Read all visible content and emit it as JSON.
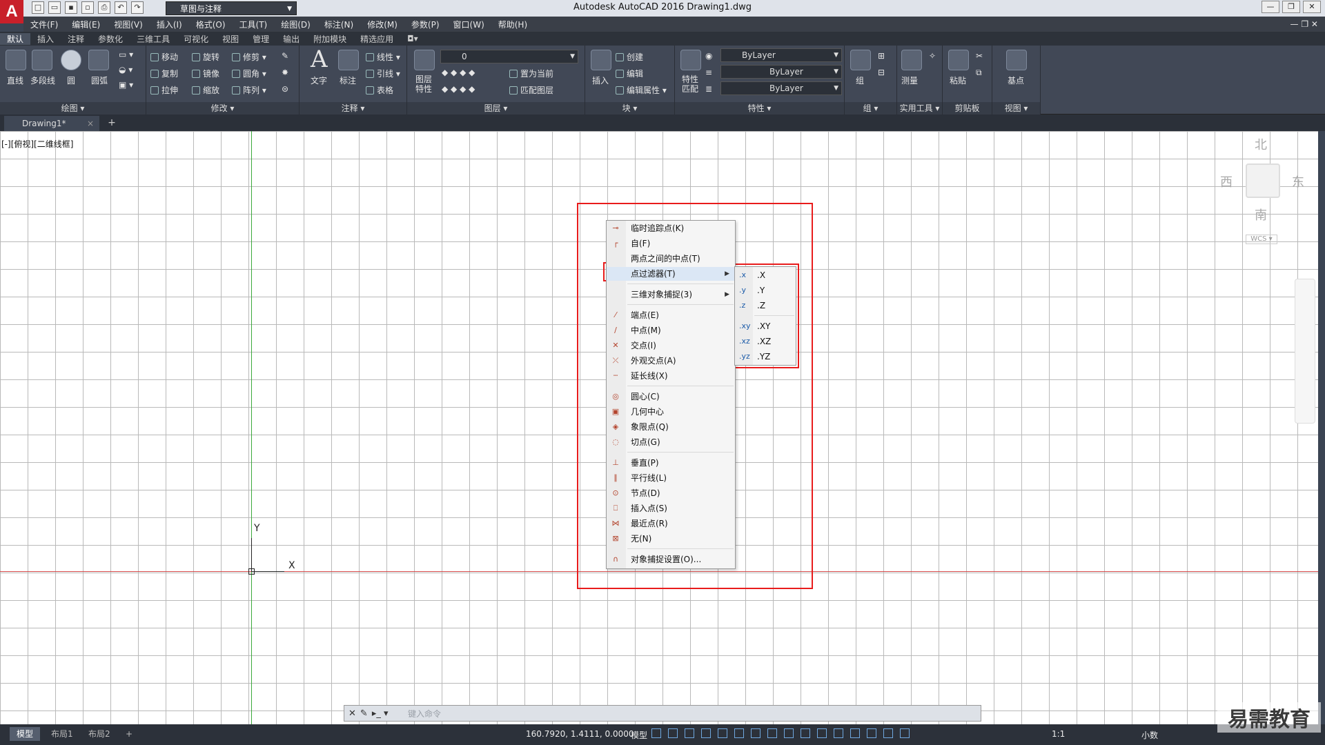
{
  "titlebar": {
    "workspace": "草图与注释",
    "title": "Autodesk AutoCAD 2016    Drawing1.dwg",
    "logo": "A"
  },
  "menubar": [
    "文件(F)",
    "编辑(E)",
    "视图(V)",
    "插入(I)",
    "格式(O)",
    "工具(T)",
    "绘图(D)",
    "标注(N)",
    "修改(M)",
    "参数(P)",
    "窗口(W)",
    "帮助(H)"
  ],
  "ribbon_tabs": [
    "默认",
    "插入",
    "注释",
    "参数化",
    "三维工具",
    "可视化",
    "视图",
    "管理",
    "输出",
    "附加模块",
    "精选应用"
  ],
  "ribbon": {
    "draw": {
      "title": "绘图",
      "line": "直线",
      "polyline": "多段线",
      "circle": "圆",
      "arc": "圆弧"
    },
    "modify": {
      "title": "修改",
      "move": "移动",
      "rotate": "旋转",
      "trim": "修剪",
      "copy": "复制",
      "mirror": "镜像",
      "fillet": "圆角",
      "stretch": "拉伸",
      "scale": "缩放",
      "array": "阵列"
    },
    "annotation": {
      "title": "注释",
      "text": "文字",
      "dim": "标注",
      "linear": "线性",
      "leader": "引线",
      "table": "表格"
    },
    "layers": {
      "title": "图层",
      "props": "图层特性",
      "layer_value": "0",
      "set_current": "置为当前",
      "match": "匹配图层"
    },
    "block": {
      "title": "块",
      "insert": "插入",
      "create": "创建",
      "edit": "编辑",
      "edit_attr": "编辑属性"
    },
    "properties": {
      "title": "特性",
      "match": "特性匹配",
      "color": "ByLayer",
      "linetype": "ByLayer",
      "lineweight": "ByLayer"
    },
    "groups": {
      "title": "组",
      "group": "组"
    },
    "utilities": {
      "title": "实用工具",
      "measure": "测量"
    },
    "clipboard": {
      "title": "剪贴板",
      "paste": "粘贴"
    },
    "view": {
      "title": "视图",
      "base": "基点"
    }
  },
  "doctab": {
    "name": "Drawing1*",
    "close": "×",
    "add": "+"
  },
  "canvas": {
    "view_label": "[-][俯视][二维线框]",
    "ucs_x": "X",
    "ucs_y": "Y",
    "viewcube": {
      "north": "北",
      "south": "南",
      "east": "东",
      "west": "西",
      "wcs": "WCS"
    }
  },
  "context_menu": [
    {
      "label": "临时追踪点(K)",
      "icon": "temp-track-icon"
    },
    {
      "label": "自(F)",
      "icon": "from-icon"
    },
    {
      "label": "两点之间的中点(T)",
      "icon": ""
    },
    {
      "label": "点过滤器(T)",
      "icon": "",
      "submenu": true,
      "highlighted": true
    },
    {
      "label": "三维对象捕捉(3)",
      "icon": "",
      "submenu": true
    },
    {
      "label": "端点(E)",
      "icon": "endpoint-icon"
    },
    {
      "label": "中点(M)",
      "icon": "midpoint-icon"
    },
    {
      "label": "交点(I)",
      "icon": "intersection-icon"
    },
    {
      "label": "外观交点(A)",
      "icon": "apparent-intersection-icon"
    },
    {
      "label": "延长线(X)",
      "icon": "extension-icon"
    },
    {
      "label": "圆心(C)",
      "icon": "center-icon"
    },
    {
      "label": "几何中心",
      "icon": "geometric-center-icon"
    },
    {
      "label": "象限点(Q)",
      "icon": "quadrant-icon"
    },
    {
      "label": "切点(G)",
      "icon": "tangent-icon"
    },
    {
      "label": "垂直(P)",
      "icon": "perpendicular-icon"
    },
    {
      "label": "平行线(L)",
      "icon": "parallel-icon"
    },
    {
      "label": "节点(D)",
      "icon": "node-icon"
    },
    {
      "label": "插入点(S)",
      "icon": "insertion-icon"
    },
    {
      "label": "最近点(R)",
      "icon": "nearest-icon"
    },
    {
      "label": "无(N)",
      "icon": "none-icon"
    },
    {
      "label": "对象捕捉设置(O)...",
      "icon": "osnap-settings-icon"
    }
  ],
  "submenu": [
    {
      "icon": ".x",
      "label": ".X"
    },
    {
      "icon": ".y",
      "label": ".Y"
    },
    {
      "icon": ".z",
      "label": ".Z"
    },
    {
      "icon": ".xy",
      "label": ".XY"
    },
    {
      "icon": ".xz",
      "label": ".XZ"
    },
    {
      "icon": ".yz",
      "label": ".YZ"
    }
  ],
  "command_line": {
    "placeholder": "键入命令"
  },
  "status": {
    "layouts": [
      "模型",
      "布局1",
      "布局2"
    ],
    "add_layout": "+",
    "coords": "160.7920, 1.4111, 0.0000",
    "mode": "模型",
    "scale": "1:1",
    "units": "小数"
  },
  "watermark": "易需教育",
  "colors": {
    "highlight_box": "#e81b1b",
    "x_axis": "#d44a4a",
    "y_axis": "#3aa83a"
  }
}
